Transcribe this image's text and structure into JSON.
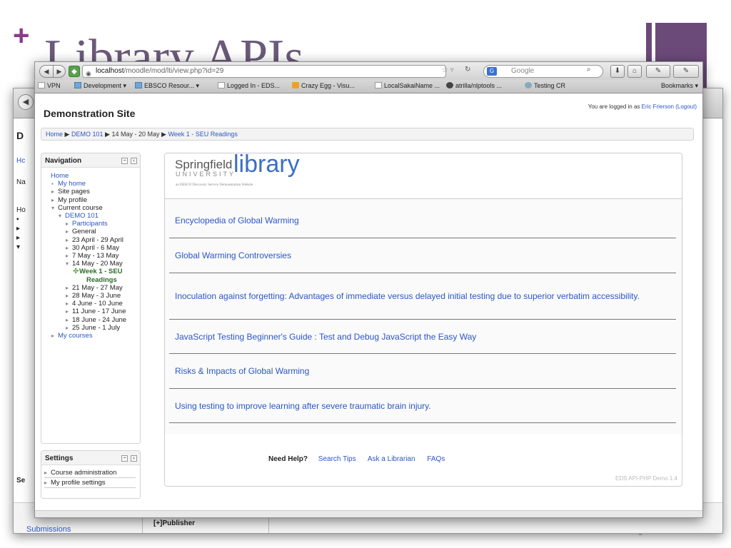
{
  "slide": {
    "plus": "+",
    "title": "Library APIs"
  },
  "back_window": {
    "nav_glyph": "◀",
    "site_initial": "D",
    "crumb": "Hc",
    "side_lines": [
      "Na",
      "",
      "",
      "Ho",
      "▪",
      "▸",
      "▸",
      "▾"
    ],
    "side_bottom": [
      "Se"
    ],
    "submissions": "Submissions",
    "publisher": "[+]Publisher"
  },
  "browser": {
    "back_glyph": "◀",
    "forward_glyph": "▶",
    "url_host": "localhost",
    "url_path": "/moodle/mod/lti/view.php?id=29",
    "search_placeholder": "Google",
    "search_engine_glyph": "G",
    "toolbar_glyphs": {
      "download": "⬇",
      "home": "⌂",
      "addon1": "✎",
      "addon2": "✎"
    },
    "bookmarks": [
      {
        "label": "VPN",
        "icon": "page"
      },
      {
        "label": "Development ▾",
        "icon": "folder"
      },
      {
        "label": "EBSCO Resour... ▾",
        "icon": "folder"
      },
      {
        "label": "Logged In - EDS...",
        "icon": "page"
      },
      {
        "label": "Crazy Egg - Visu...",
        "icon": "orange"
      },
      {
        "label": "LocalSakaiName ...",
        "icon": "page"
      },
      {
        "label": "atrilla/nlptools ...",
        "icon": "octo"
      },
      {
        "label": "Testing CR",
        "icon": "globe"
      }
    ],
    "bookmarks_menu": "Bookmarks ▾"
  },
  "moodle": {
    "site_title": "Demonstration Site",
    "login_prefix": "You are logged in as",
    "login_user": "Eric Frierson",
    "login_logout": "(Logout)",
    "breadcrumb": {
      "home": "Home",
      "sep": "▶",
      "course": "DEMO 101",
      "week": "14 May - 20 May",
      "page": "Week 1 - SEU Readings"
    },
    "navigation": {
      "title": "Navigation",
      "items": [
        {
          "text": "Home",
          "indent": 0,
          "arrow": "",
          "link": true
        },
        {
          "text": "My home",
          "indent": 1,
          "arrow": "▪",
          "link": true
        },
        {
          "text": "Site pages",
          "indent": 1,
          "arrow": "▸",
          "link": false
        },
        {
          "text": "My profile",
          "indent": 1,
          "arrow": "▸",
          "link": false
        },
        {
          "text": "Current course",
          "indent": 1,
          "arrow": "▾",
          "link": false
        },
        {
          "text": "DEMO 101",
          "indent": 2,
          "arrow": "▾",
          "link": true
        },
        {
          "text": "Participants",
          "indent": 3,
          "arrow": "▸",
          "link": true
        },
        {
          "text": "General",
          "indent": 3,
          "arrow": "▸",
          "link": false
        },
        {
          "text": "23 April - 29 April",
          "indent": 3,
          "arrow": "▸",
          "link": false
        },
        {
          "text": "30 April - 6 May",
          "indent": 3,
          "arrow": "▸",
          "link": false
        },
        {
          "text": "7 May - 13 May",
          "indent": 3,
          "arrow": "▸",
          "link": false
        },
        {
          "text": "14 May - 20 May",
          "indent": 3,
          "arrow": "▾",
          "link": false
        },
        {
          "text": "Week 1 - SEU",
          "indent": 4,
          "arrow": "✤",
          "link": false,
          "current": true
        },
        {
          "text": "Readings",
          "indent": 5,
          "arrow": "",
          "link": false,
          "current": true
        },
        {
          "text": "21 May - 27 May",
          "indent": 3,
          "arrow": "▸",
          "link": false
        },
        {
          "text": "28 May - 3 June",
          "indent": 3,
          "arrow": "▸",
          "link": false
        },
        {
          "text": "4 June - 10 June",
          "indent": 3,
          "arrow": "▸",
          "link": false
        },
        {
          "text": "11 June - 17 June",
          "indent": 3,
          "arrow": "▸",
          "link": false
        },
        {
          "text": "18 June - 24 June",
          "indent": 3,
          "arrow": "▸",
          "link": false
        },
        {
          "text": "25 June - 1 July",
          "indent": 3,
          "arrow": "▸",
          "link": false
        },
        {
          "text": "My courses",
          "indent": 1,
          "arrow": "▸",
          "link": true
        }
      ]
    },
    "settings": {
      "title": "Settings",
      "items": [
        "Course administration",
        "My profile settings"
      ],
      "arrow": "▸"
    },
    "block_controls": {
      "collapse": "−",
      "dock": "‹"
    }
  },
  "library": {
    "springfield": "Springfield",
    "university": "UNIVERSITY",
    "library_word": "library",
    "tagline": "an EBSCO Discovery Service Demonstration Website",
    "results": [
      "Encyclopedia of Global Warming",
      "Global Warming Controversies",
      "Inoculation against forgetting: Advantages of immediate versus delayed initial testing due to superior verbatim accessibility.",
      "JavaScript Testing Beginner's Guide : Test and Debug JavaScript the Easy Way",
      "Risks & Impacts of Global Warming",
      "Using testing to improve learning after severe traumatic brain injury."
    ],
    "help_label": "Need Help?",
    "help_links": [
      "Search Tips",
      "Ask a Librarian",
      "FAQs"
    ],
    "version": "EDS API-PHP Demo 1.4"
  },
  "colors": {
    "accent_purple": "#6b4a7a",
    "link_blue": "#2a56c6",
    "library_blue": "#3b6fc4"
  }
}
